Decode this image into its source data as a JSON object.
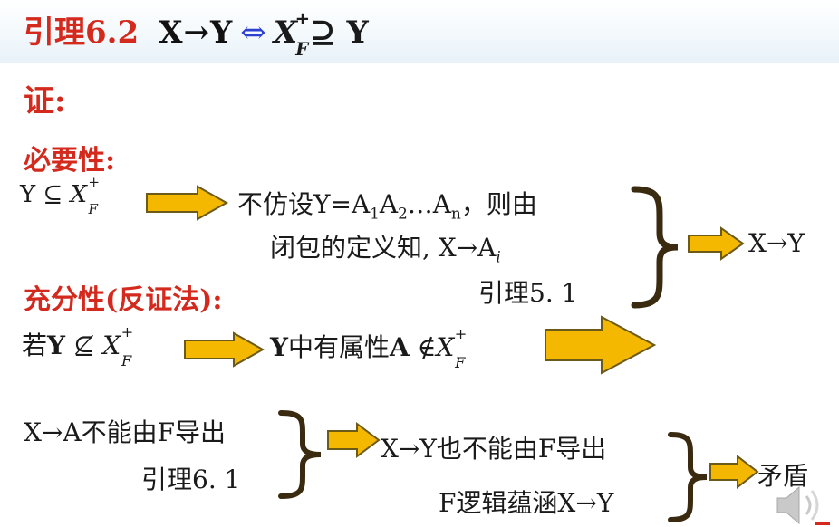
{
  "title": {
    "lemma_label": "引理6.2",
    "rel_left": "X→Y",
    "iff": "⇔",
    "closure_var": "X",
    "closure_sup": "+",
    "closure_sub": "F",
    "superset": "⊇",
    "rel_right": "Y"
  },
  "proof_label": "证:",
  "necessity": {
    "heading": "必要性:",
    "premise_left": "Y ⊆",
    "assume_line": "不仿设Y=A",
    "assume_sub1": "1",
    "assume_a2": "A",
    "assume_sub2": "2",
    "assume_dots": "…A",
    "assume_subn": "n",
    "assume_tail": "，则由",
    "closure_line": "闭包的定义知, X→A",
    "closure_sub_i": "i",
    "lemma_ref": "引理5. 1",
    "result": "X→Y"
  },
  "sufficiency": {
    "heading": "充分性(反证法):",
    "premise_if": "若",
    "premise_y": "Y",
    "premise_notsub": "⊈",
    "has_attr_y": "Y",
    "has_attr_text": "中有属性",
    "has_attr_a": "A",
    "not_in": "∉",
    "line1_left": "X→A不能由F导出",
    "line2_left": "引理6. 1",
    "middle_text": "X→Y也不能由F导出",
    "bottom_text": "F逻辑蕴涵X→Y",
    "conclusion": "矛盾"
  },
  "colors": {
    "heading_red": "#d42a1e",
    "arrow_fill": "#f5b800",
    "arrow_stroke": "#6b5a18",
    "iff_blue": "#2b3fd0",
    "brace_brown": "#3a2a10"
  },
  "icons": [
    "right-arrow-icon",
    "right-brace-icon",
    "speaker-icon"
  ]
}
